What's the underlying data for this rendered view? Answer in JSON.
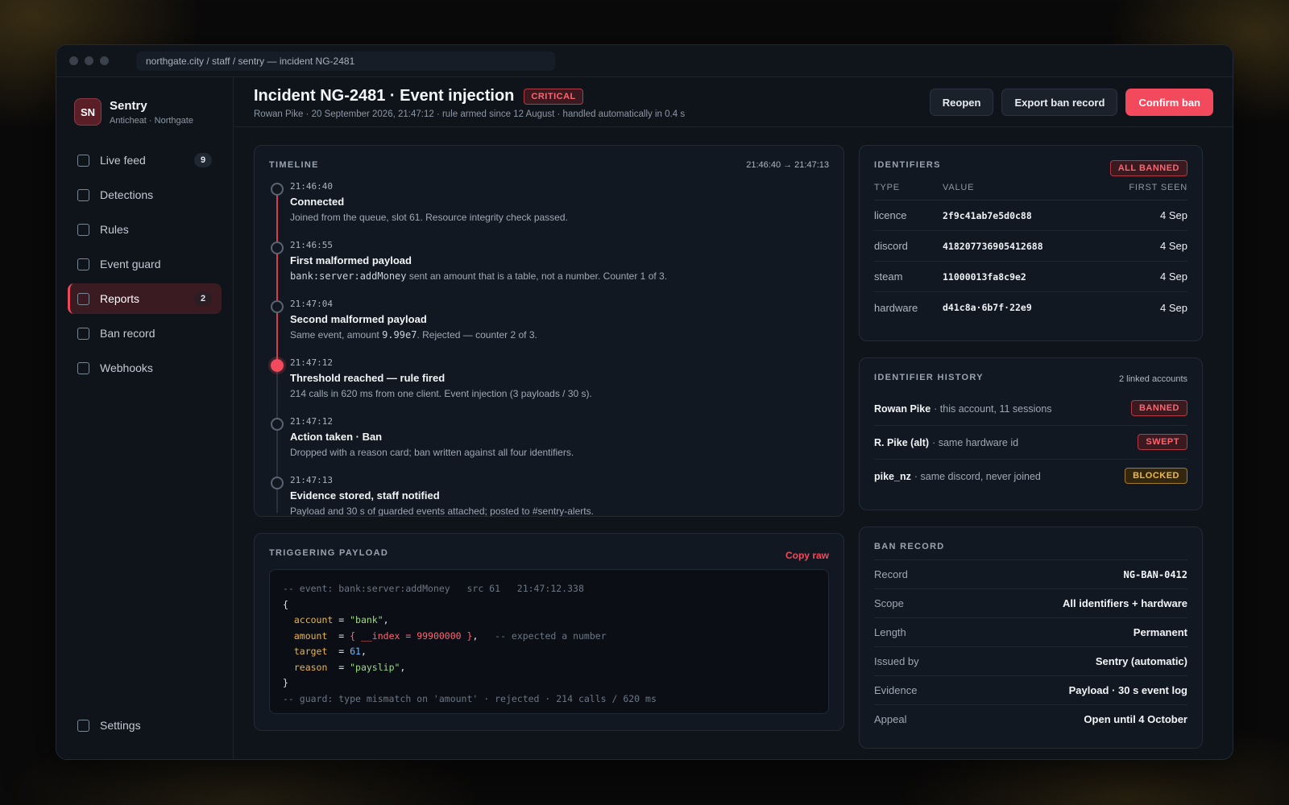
{
  "window": {
    "url": "northgate.city / staff / sentry — incident NG-2481"
  },
  "brand": {
    "initials": "SN",
    "name": "Sentry",
    "sub": "Anticheat · Northgate"
  },
  "nav": {
    "items": [
      {
        "label": "Live feed",
        "count": "9"
      },
      {
        "label": "Detections"
      },
      {
        "label": "Rules"
      },
      {
        "label": "Event guard"
      },
      {
        "label": "Reports",
        "count": "2",
        "active": true
      },
      {
        "label": "Ban record"
      },
      {
        "label": "Webhooks"
      }
    ],
    "settings": "Settings"
  },
  "header": {
    "title": "Incident NG-2481 · Event injection",
    "severity": "CRITICAL",
    "subtitle": "Rowan Pike · 20 September 2026, 21:47:12 · rule armed since 12 August · handled automatically in 0.4 s",
    "actions": {
      "reopen": "Reopen",
      "export": "Export ban record",
      "confirm": "Confirm ban"
    }
  },
  "timeline": {
    "title": "TIMELINE",
    "range": "21:46:40 → 21:47:13",
    "events": [
      {
        "time": "21:46:40",
        "title": "Connected",
        "desc": "Joined from the queue, slot 61. Resource integrity check passed."
      },
      {
        "time": "21:46:55",
        "title": "First malformed payload",
        "code": "bank:server:addMoney",
        "desc": " sent an amount that is a table, not a number. Counter 1 of 3."
      },
      {
        "time": "21:47:04",
        "title": "Second malformed payload",
        "desc_pre": "Same event, amount ",
        "code": "9.99e7",
        "desc": ". Rejected — counter 2 of 3."
      },
      {
        "time": "21:47:12",
        "title": "Threshold reached — rule fired",
        "desc": "214 calls in 620 ms from one client. Event injection (3 payloads / 30 s)."
      },
      {
        "time": "21:47:12",
        "title": "Action taken · Ban",
        "desc": "Dropped with a reason card; ban written against all four identifiers."
      },
      {
        "time": "21:47:13",
        "title": "Evidence stored, staff notified",
        "desc": "Payload and 30 s of guarded events attached; posted to #sentry-alerts."
      }
    ]
  },
  "payload": {
    "title": "TRIGGERING PAYLOAD",
    "copy": "Copy raw",
    "line1": "-- event: bank:server:addMoney   src 61   21:47:12.338",
    "open": "{",
    "account_key": "account",
    "account_val": "\"bank\"",
    "amount_key": "amount",
    "amount_val": "{ __index = 99900000 }",
    "amount_comment": "-- expected a number",
    "target_key": "target",
    "target_val": "61",
    "reason_key": "reason",
    "reason_val": "\"payslip\"",
    "close": "}",
    "footer": "-- guard: type mismatch on 'amount' · rejected · 214 calls / 620 ms"
  },
  "identifiers": {
    "title": "IDENTIFIERS",
    "badge": "ALL BANNED",
    "headers": {
      "type": "TYPE",
      "value": "VALUE",
      "seen": "FIRST SEEN"
    },
    "rows": [
      {
        "type": "licence",
        "value": "2f9c41ab7e5d0c88",
        "seen": "4 Sep"
      },
      {
        "type": "discord",
        "value": "418207736905412688",
        "seen": "4 Sep"
      },
      {
        "type": "steam",
        "value": "11000013fa8c9e2",
        "seen": "4 Sep"
      },
      {
        "type": "hardware",
        "value": "d41c8a·6b7f·22e9",
        "seen": "4 Sep"
      }
    ]
  },
  "history": {
    "title": "IDENTIFIER HISTORY",
    "linked": "2 linked accounts",
    "rows": [
      {
        "name": "Rowan Pike",
        "note": "· this account, 11 sessions",
        "status": "BANNED"
      },
      {
        "name": "R. Pike (alt)",
        "note": "· same hardware id",
        "status": "SWEPT"
      },
      {
        "name": "pike_nz",
        "note": "· same discord, never joined",
        "status": "BLOCKED"
      }
    ]
  },
  "ban_record": {
    "title": "BAN RECORD",
    "rows": [
      {
        "label": "Record",
        "value": "NG-BAN-0412"
      },
      {
        "label": "Scope",
        "value": "All identifiers + hardware"
      },
      {
        "label": "Length",
        "value": "Permanent"
      },
      {
        "label": "Issued by",
        "value": "Sentry (automatic)"
      },
      {
        "label": "Evidence",
        "value": "Payload · 30 s event log"
      },
      {
        "label": "Appeal",
        "value": "Open until 4 October"
      }
    ]
  },
  "colors": {
    "accent": "#f24a5c",
    "danger_bg": "#3a1a1f",
    "warning": "#f0b94a"
  }
}
